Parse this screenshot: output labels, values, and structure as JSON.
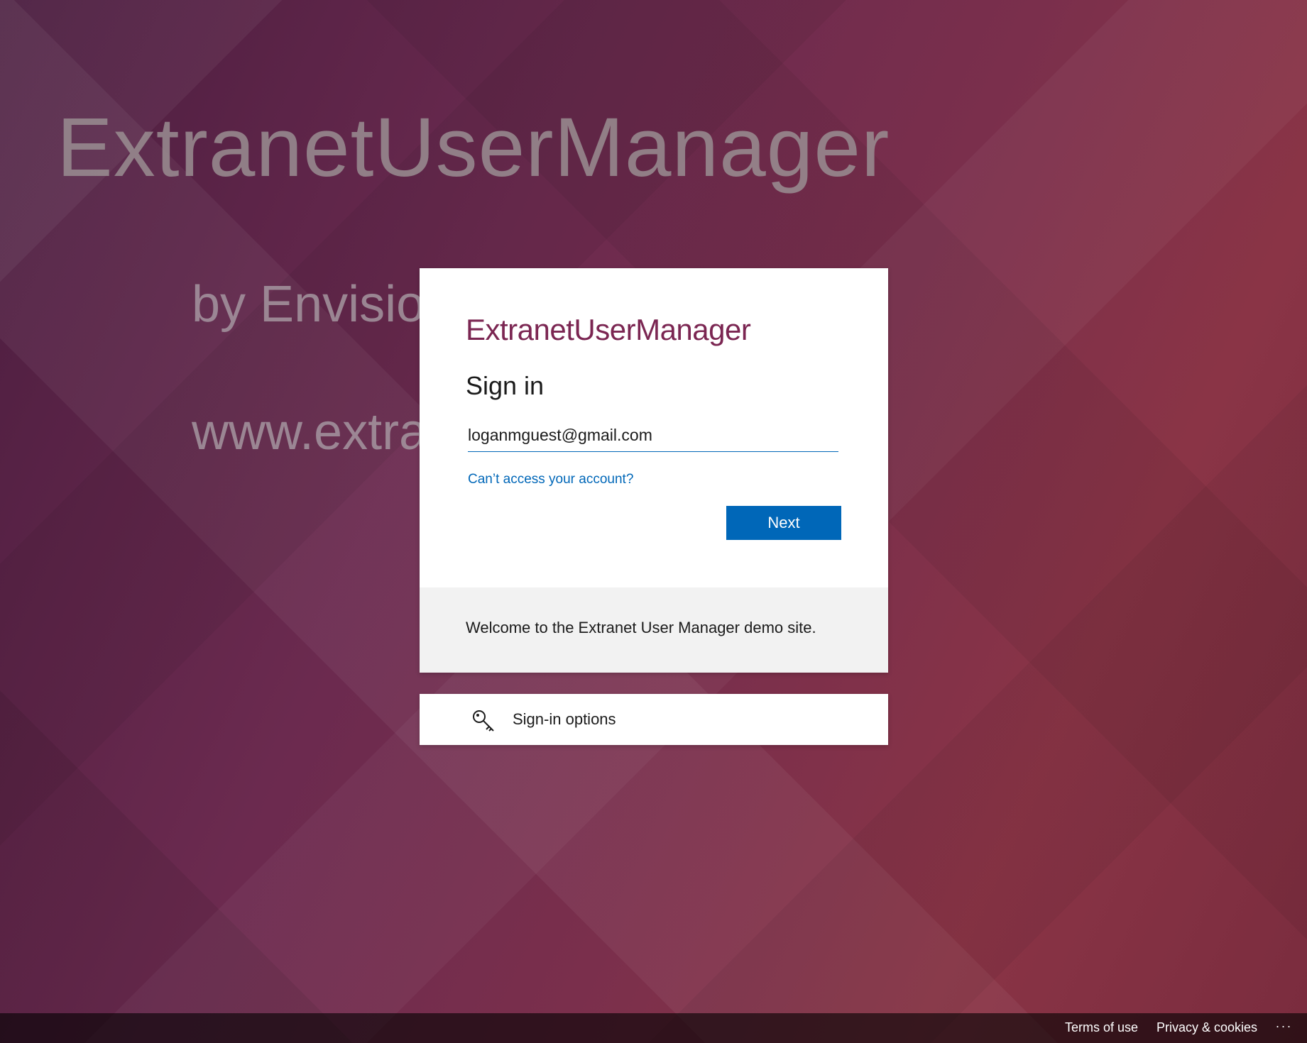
{
  "background": {
    "logo_text": "ExtranetUserManager",
    "by_text": "by Envisio",
    "url_text": "www.extra"
  },
  "signin": {
    "brand_logo": "ExtranetUserManager",
    "title": "Sign in",
    "email_value": "loganmguest@gmail.com",
    "cant_access_link": "Can’t access your account?",
    "next_label": "Next",
    "welcome_message": "Welcome to the Extranet User Manager demo site."
  },
  "options": {
    "label": "Sign-in options",
    "icon": "key-icon"
  },
  "footer": {
    "terms": "Terms of use",
    "privacy": "Privacy & cookies",
    "more": "..."
  },
  "colors": {
    "accent": "#0067b8",
    "brand": "#7b2652"
  }
}
